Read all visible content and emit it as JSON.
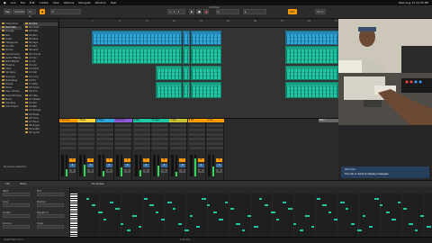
{
  "menubar": {
    "items": [
      "Live",
      "File",
      "Edit",
      "Create",
      "View",
      "Options",
      "Navigate",
      "Window",
      "Help"
    ],
    "clock": "Wed Aug 13 12:35 PM"
  },
  "controlbar": {
    "window_title": "Untitled",
    "tap_label": "Tap",
    "tempo": "120.00",
    "signature": "4 / 4",
    "position": "1 . 1 . 1",
    "cpu": "12 %"
  },
  "browser": {
    "places": [
      "Collections",
      "Favorites",
      "Orange",
      "Red",
      "Green",
      "Categories",
      "Sounds",
      "Drums",
      "Instruments",
      "Audio Effects",
      "MIDI Effects",
      "Plug-Ins",
      "Clips",
      "Samples",
      "Grooves",
      "Templates",
      "Places",
      "Packs",
      "User Library",
      "Current Project",
      "Music",
      "Samples",
      "Add Folder..."
    ],
    "files": [
      "01 Kick",
      "02 Snare",
      "03 Hats",
      "04 Perc",
      "05 Bass",
      "06 Keys",
      "07 Pad",
      "08 Lead",
      "09 Chords",
      "10 Vox",
      "11 FX",
      "12 Arp",
      "13 Pluck",
      "14 Sub",
      "15 Loop",
      "16 Fill",
      "17 Ride",
      "18 Crash",
      "19 Tom",
      "20 Clap",
      "21 Shaker",
      "22 Rim",
      "23 Bell",
      "24 Strings",
      "25 Brass",
      "26 Choir",
      "27 Piano",
      "28 Organ",
      "29 Guitar",
      "30 Synth"
    ],
    "info": "No device selected"
  },
  "arrangement": {
    "ruler_ticks": [
      "1",
      "9",
      "17",
      "25",
      "33",
      "41",
      "49",
      "57",
      "65",
      "73"
    ],
    "locator": "Create a Locator"
  },
  "mixer": {
    "strips": [
      {
        "name": "1 Drums",
        "color": "#ff9a00",
        "meter": 0.35
      },
      {
        "name": "2 Bass",
        "color": "#ffd23a",
        "meter": 0.55
      },
      {
        "name": "3 Keys",
        "color": "#2fa7d9",
        "meter": 0.25
      },
      {
        "name": "4 Chords",
        "color": "#8e5ad6",
        "meter": 0.4
      },
      {
        "name": "5 Pad",
        "color": "#20c6a3",
        "meter": 0.3
      },
      {
        "name": "6 Lead",
        "color": "#20c6a3",
        "meter": 0.5
      },
      {
        "name": "7 Arp",
        "color": "#c8c232",
        "meter": 0.2
      },
      {
        "name": "8 FX",
        "color": "#ff9a00",
        "meter": 0.85
      },
      {
        "name": "9 Vox",
        "color": "#ff9a00",
        "meter": 0.45
      }
    ],
    "master_label": "Main"
  },
  "notification": {
    "title": "Welcome",
    "message": "The clip is ready to display messages"
  },
  "detail": {
    "tabs": [
      "Clip",
      "Notes",
      "Envelopes"
    ],
    "clip_fields": [
      "Start",
      "End",
      "Loop",
      "Position",
      "Length",
      "Signature",
      "Groove",
      "Scale"
    ]
  },
  "statusbar": {
    "left": "Insert Mark 1.1.1",
    "right": "1 Drums"
  },
  "colors": {
    "accent": "#ff9a00",
    "cyan_clip": "#2fa7d9",
    "teal_clip": "#20c6a3"
  }
}
